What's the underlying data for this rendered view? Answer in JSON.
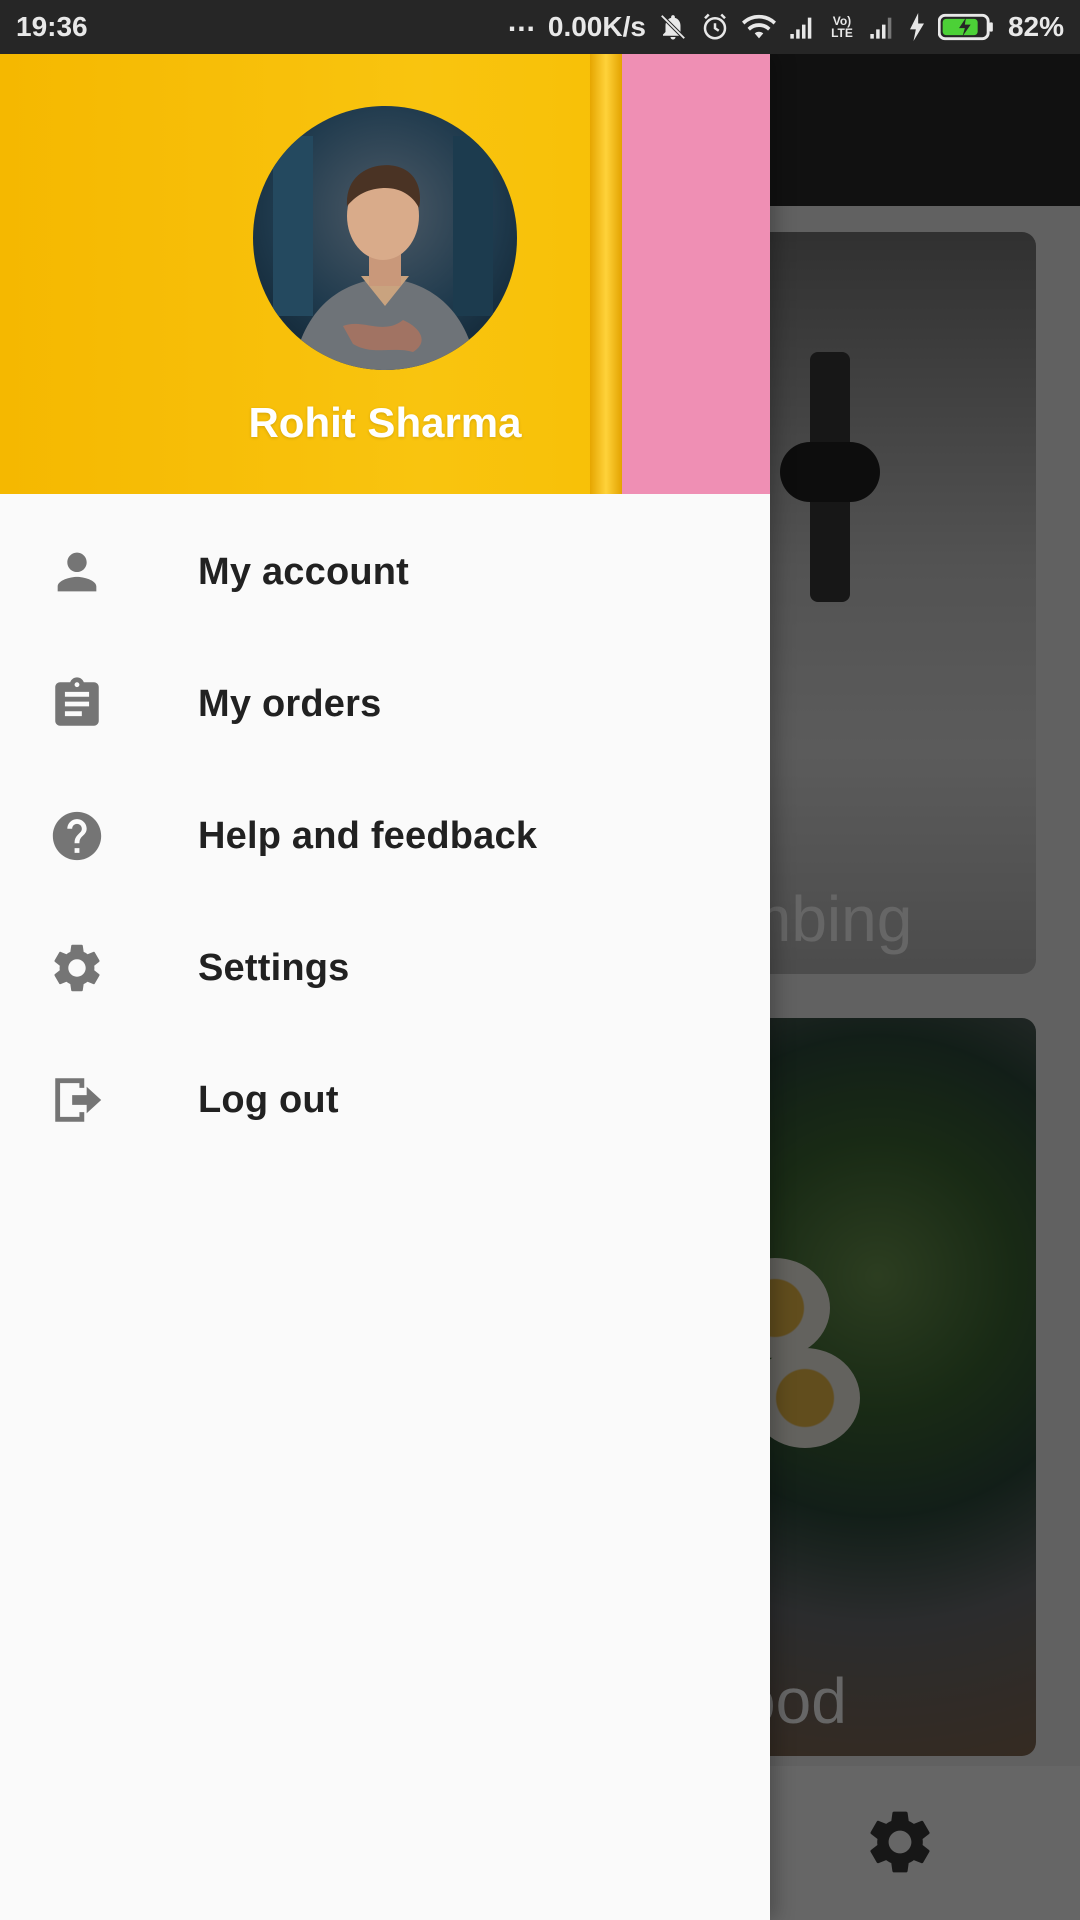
{
  "status_bar": {
    "time": "19:36",
    "more_indicator": "...",
    "network_speed": "0.00K/s",
    "volte_label": "Vo) LTE",
    "battery_percent": "82%",
    "icons": [
      "mute-icon",
      "alarm-icon",
      "wifi-icon",
      "signal-icon",
      "volte-icon",
      "signal-icon",
      "charging-icon",
      "battery-icon"
    ]
  },
  "drawer": {
    "user_name": "Rohit Sharma",
    "menu": [
      {
        "label": "My account",
        "icon": "person-icon"
      },
      {
        "label": "My orders",
        "icon": "clipboard-icon"
      },
      {
        "label": "Help and feedback",
        "icon": "help-icon"
      },
      {
        "label": "Settings",
        "icon": "gear-icon"
      },
      {
        "label": "Log out",
        "icon": "logout-icon"
      }
    ]
  },
  "background": {
    "cards": [
      {
        "title_visible": "mbing"
      },
      {
        "title_visible": "ood"
      }
    ],
    "bottom_icon": "gear-icon"
  },
  "colors": {
    "header_yellow": "#f9c40f",
    "header_pink": "#ef8fb4",
    "drawer_bg": "#fafafa",
    "icon_gray": "#757575",
    "text": "#212121"
  }
}
